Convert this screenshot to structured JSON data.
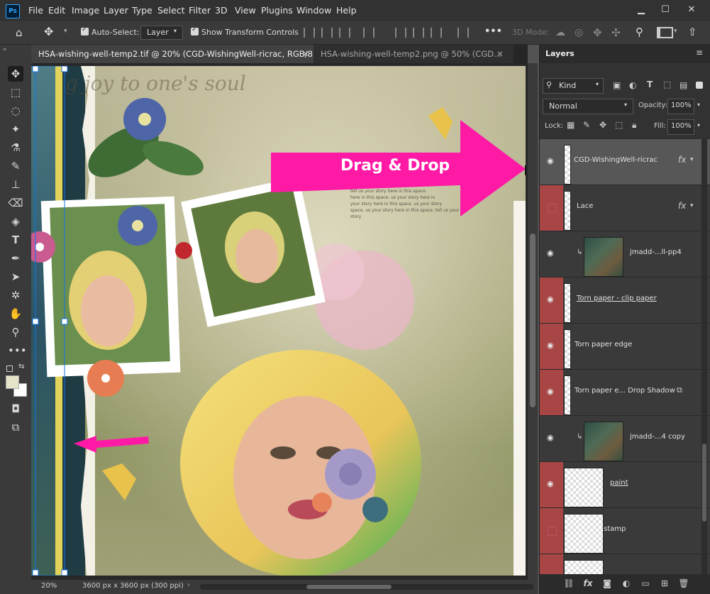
{
  "app": {
    "logo": "Ps"
  },
  "menu": [
    "File",
    "Edit",
    "Image",
    "Layer",
    "Type",
    "Select",
    "Filter",
    "3D",
    "View",
    "Plugins",
    "Window",
    "Help"
  ],
  "window_controls": [
    "▁",
    "☐",
    "✕"
  ],
  "options": {
    "auto_select_label": "Auto-Select:",
    "auto_select_value": "Layer",
    "show_transform_label": "Show Transform Controls",
    "mode_3d": "3D Mode:",
    "more": "•••"
  },
  "tabs": [
    {
      "label": "HSA-wishing-well-temp2.tif @ 20% (CGD-WishingWell-ricrac, RGB/8) *",
      "active": true
    },
    {
      "label": "HSA-wishing-well-temp2.png @ 50% (CGD...",
      "active": false
    }
  ],
  "canvas": {
    "callout_text": "Drag & Drop",
    "script_text": "g joy to one's soul",
    "journal_lines": [
      "tell us your story here in this space.",
      "here in this space. us your story here in",
      "your story here in this space. us your story",
      "space. us your story here in this space. tell us your story"
    ],
    "accent_color": "#ff1aa6"
  },
  "status": {
    "zoom": "20%",
    "doc_info": "3600 px x 3600 px (300 ppi)"
  },
  "layers_panel": {
    "title": "Layers",
    "filter_kind": "Kind",
    "blend_mode": "Normal",
    "opacity_label": "Opacity:",
    "opacity_value": "100%",
    "lock_label": "Lock:",
    "fill_label": "Fill:",
    "fill_value": "100%",
    "layers": [
      {
        "name": "CGD-WishingWell-ricrac",
        "visible": true,
        "selected": true,
        "fx": "fx",
        "thumb": "thin"
      },
      {
        "name": "Lace",
        "visible": false,
        "selected": false,
        "fx": "fx",
        "thumb": "thin"
      },
      {
        "name": "jmadd-...ll-pp4",
        "visible": true,
        "selected": false,
        "fx": "",
        "thumb": "img",
        "clipped": true
      },
      {
        "name": "Torn paper - clip paper",
        "visible": true,
        "selected": false,
        "fx": "",
        "thumb": "thin"
      },
      {
        "name": "Torn paper edge",
        "visible": true,
        "selected": false,
        "fx": "",
        "thumb": "thin"
      },
      {
        "name": "Torn paper e... Drop Shadow",
        "visible": true,
        "selected": false,
        "fx": "",
        "thumb": "thin"
      },
      {
        "name": "jmadd-...4 copy",
        "visible": true,
        "selected": false,
        "fx": "",
        "thumb": "img",
        "clipped": true
      },
      {
        "name": "paint",
        "visible": true,
        "selected": false,
        "fx": "",
        "thumb": "checker"
      },
      {
        "name": "stamp",
        "visible": false,
        "selected": false,
        "fx": "",
        "thumb": "checker"
      },
      {
        "name": "",
        "visible": false,
        "selected": false,
        "fx": "",
        "thumb": "checker"
      }
    ],
    "footer_icons": [
      "link-icon",
      "fx-icon",
      "mask-icon",
      "adjustment-icon",
      "group-icon",
      "new-layer-icon",
      "trash-icon"
    ]
  }
}
